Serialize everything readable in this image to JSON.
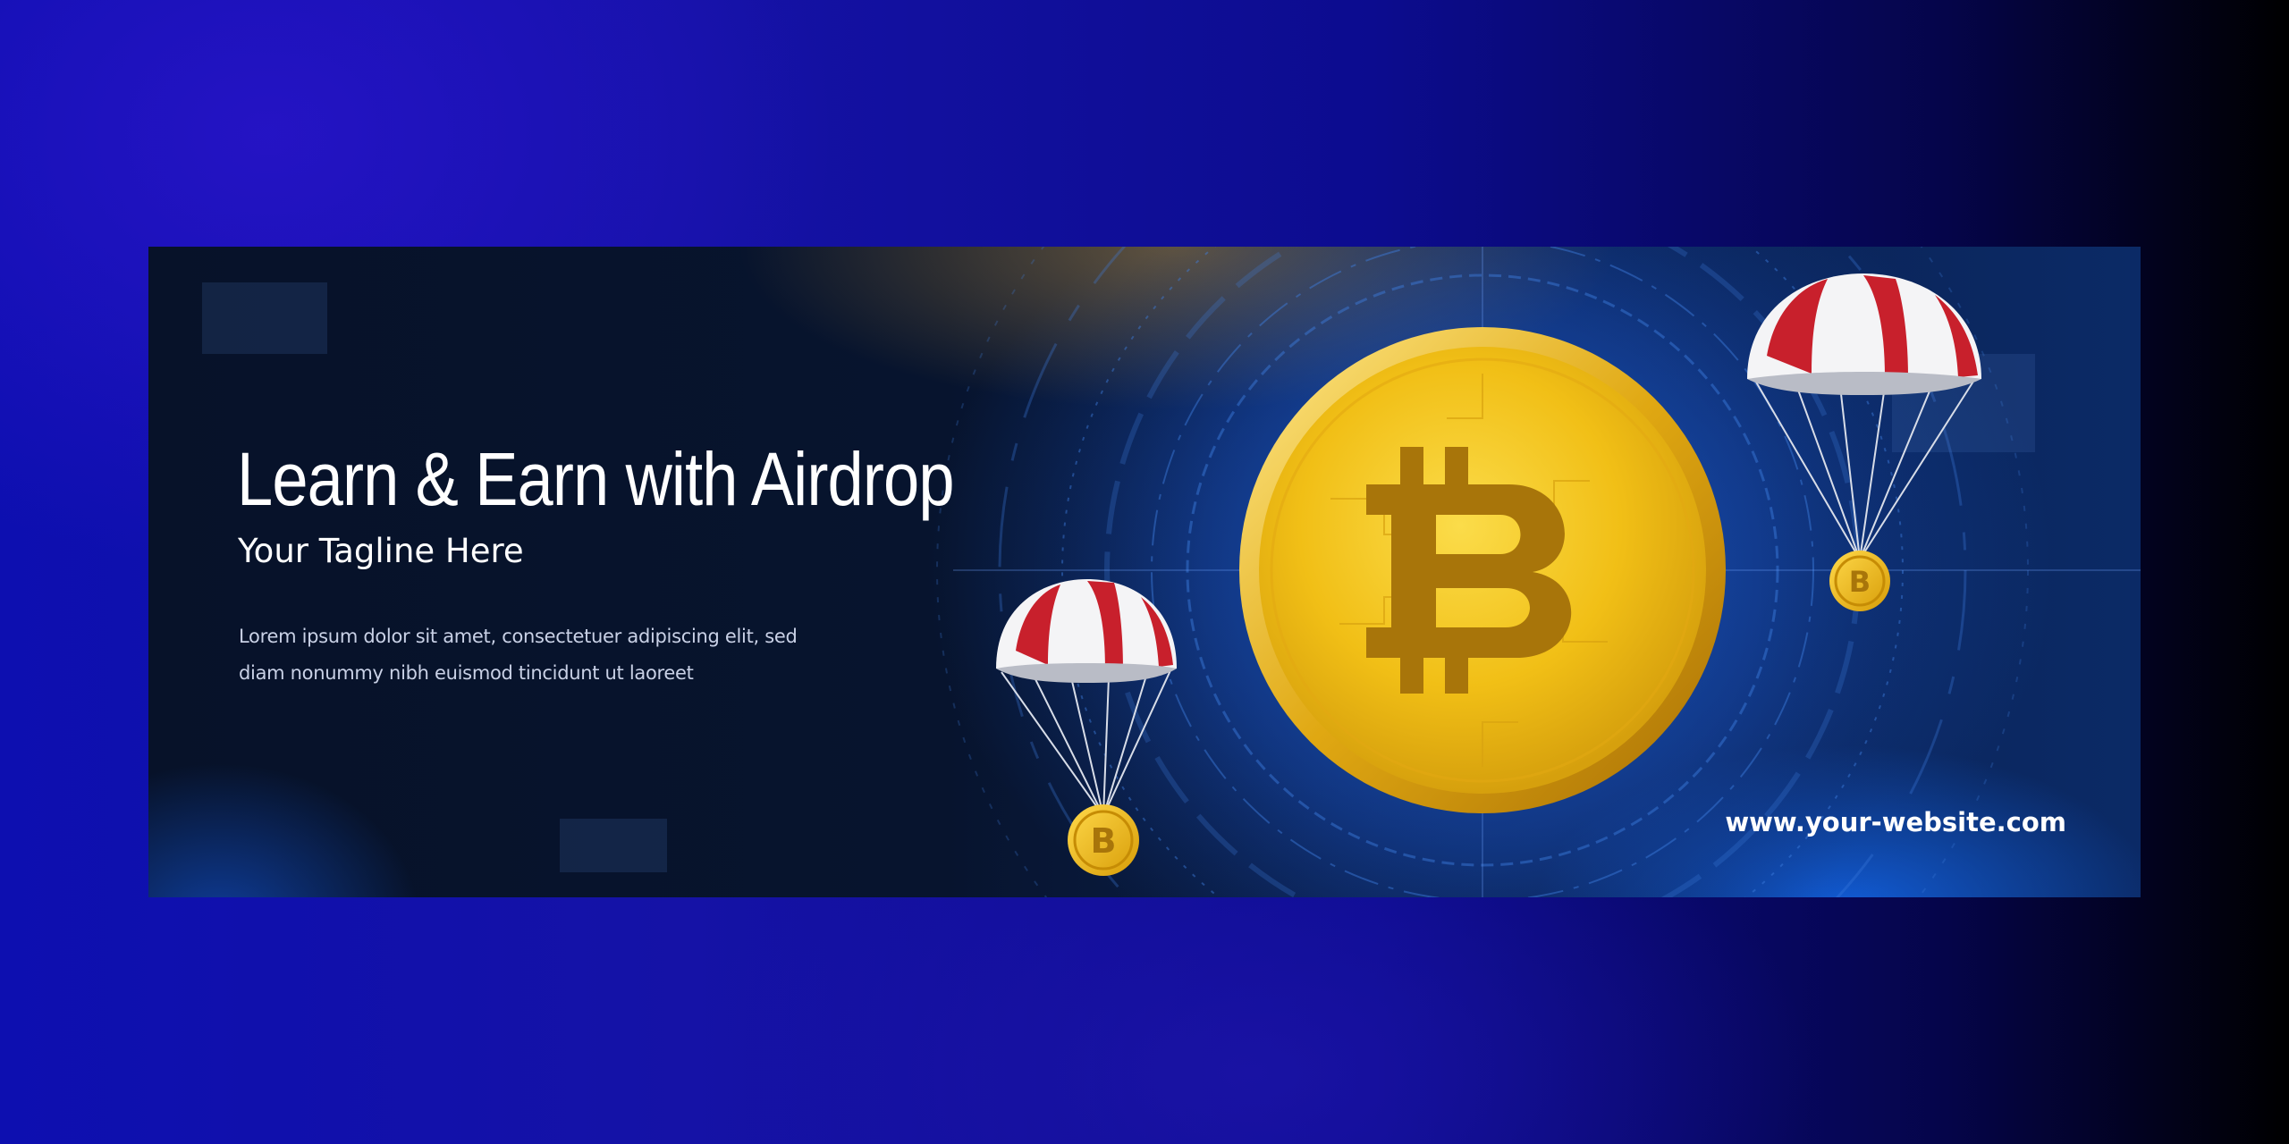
{
  "banner": {
    "headline": "Learn & Earn with Airdrop",
    "tagline": "Your Tagline Here",
    "body_lines": [
      "Lorem ipsum dolor sit amet, consectetuer adipiscing elit, sed",
      "diam nonummy nibh euismod tincidunt ut laoreet"
    ],
    "website": "www.your-website.com"
  },
  "icons": {
    "main_coin": "bitcoin-coin-icon",
    "left_parachute": "parachute-bitcoin-icon",
    "right_parachute": "parachute-bitcoin-icon"
  },
  "colors": {
    "page_background": "#1512a6",
    "banner_background": "#07142e",
    "coin_gold": "#f2c21a",
    "parachute_red": "#c8202c",
    "text": "#ffffff"
  }
}
